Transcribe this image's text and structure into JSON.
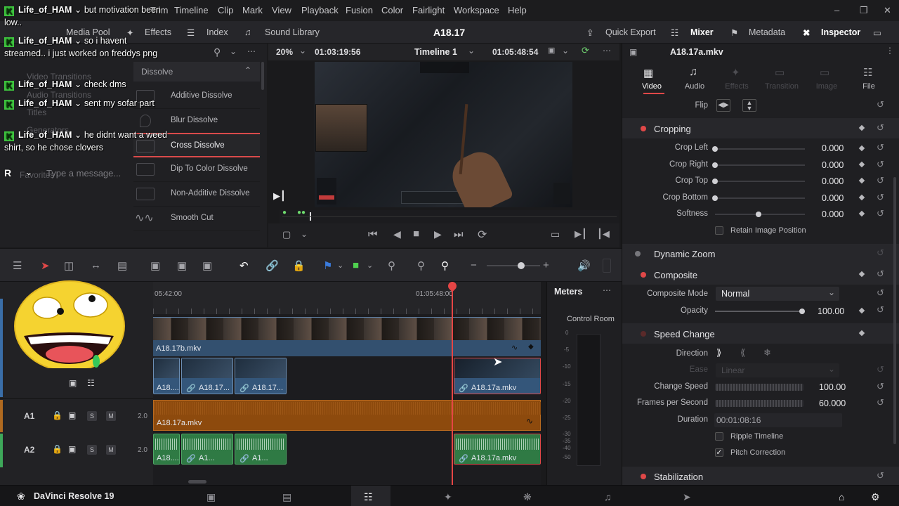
{
  "menu": {
    "items": [
      "Trim",
      "Timeline",
      "Clip",
      "Mark",
      "View",
      "Playback",
      "Fusion",
      "Color",
      "Fairlight",
      "Workspace",
      "Help"
    ]
  },
  "toolbar": {
    "media_pool": "Media Pool",
    "effects": "Effects",
    "index": "Index",
    "sound_library": "Sound Library",
    "project_name": "A18.17",
    "quick_export": "Quick Export",
    "mixer": "Mixer",
    "metadata": "Metadata",
    "inspector": "Inspector"
  },
  "effects": {
    "tree": [
      "Video Transitions",
      "Audio Transitions",
      "Titles",
      "Generators",
      "Favorites"
    ],
    "section": "Dissolve",
    "items": [
      "Additive Dissolve",
      "Blur Dissolve",
      "Cross Dissolve",
      "Dip To Color Dissolve",
      "Non-Additive Dissolve",
      "Smooth Cut"
    ],
    "selected": "Cross Dissolve"
  },
  "viewer": {
    "zoom": "20%",
    "source_tc": "01:03:19:56",
    "timeline_name": "Timeline 1",
    "record_tc": "01:05:48:54",
    "clip_name": "A18.17a.mkv"
  },
  "inspector": {
    "tabs": [
      "Video",
      "Audio",
      "Effects",
      "Transition",
      "Image",
      "File"
    ],
    "active_tab": "Video",
    "flip_label": "Flip",
    "cropping": {
      "title": "Cropping",
      "rows": [
        {
          "label": "Crop Left",
          "value": "0.000"
        },
        {
          "label": "Crop Right",
          "value": "0.000"
        },
        {
          "label": "Crop Top",
          "value": "0.000"
        },
        {
          "label": "Crop Bottom",
          "value": "0.000"
        },
        {
          "label": "Softness",
          "value": "0.000"
        }
      ],
      "retain": "Retain Image Position"
    },
    "dynamic_zoom": "Dynamic Zoom",
    "composite": {
      "title": "Composite",
      "mode_label": "Composite Mode",
      "mode_value": "Normal",
      "opacity_label": "Opacity",
      "opacity_value": "100.00"
    },
    "speed": {
      "title": "Speed Change",
      "direction_label": "Direction",
      "ease_label": "Ease",
      "ease_value": "Linear",
      "change_speed_label": "Change Speed",
      "change_speed_value": "100.00",
      "fps_label": "Frames per Second",
      "fps_value": "60.000",
      "duration_label": "Duration",
      "duration_value": "00:01:08:16",
      "ripple": "Ripple Timeline",
      "pitch": "Pitch Correction"
    },
    "stabilization": "Stabilization"
  },
  "timeline": {
    "ruler_left": "05:42:00",
    "ruler_mid": "01:05:48:00",
    "video_track_clip": "A18.17b.mkv",
    "v1_clips": [
      "A18....",
      "A18.17...",
      "A18.17..."
    ],
    "v1_active_clip": "A18.17a.mkv",
    "a1": {
      "name": "A1",
      "level": "2.0",
      "clip": "A18.17a.mkv"
    },
    "a2": {
      "name": "A2",
      "level": "2.0",
      "clips": [
        "A18....",
        "A1...",
        "A1..."
      ],
      "active_clip": "A18.17a.mkv"
    },
    "solo": "S",
    "mute": "M"
  },
  "meters": {
    "title": "Meters",
    "control_room": "Control Room",
    "scale": [
      "0",
      "-5",
      "-10",
      "-15",
      "-20",
      "-25",
      "-30",
      "-35",
      "-40",
      "-50"
    ]
  },
  "app": {
    "name": "DaVinci Resolve 19"
  },
  "chat": {
    "messages": [
      {
        "user": "Life_of_HAM",
        "text": "but motivation been low.."
      },
      {
        "user": "Life_of_HAM",
        "text": "so i havent streamed.. i just worked on freddys png"
      },
      {
        "user": "Life_of_HAM",
        "text": "check dms"
      },
      {
        "user": "Life_of_HAM",
        "text": "sent my sofar part"
      },
      {
        "user": "Life_of_HAM",
        "text": "he didnt want a weed shirt, so he chose clovers"
      }
    ],
    "input_avatar": "R",
    "placeholder": "Type a message..."
  },
  "colors": {
    "accent_red": "#e04848",
    "playhead": "#e64545",
    "clip_blue": "#34567a",
    "audio_green": "#2f7a44",
    "audio_orange": "#8d4a0d",
    "chat_badge": "#3ec53e"
  }
}
